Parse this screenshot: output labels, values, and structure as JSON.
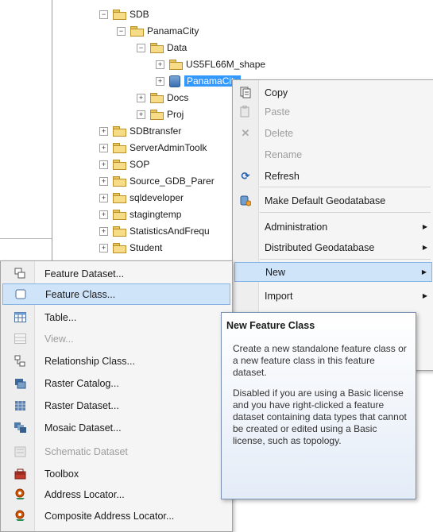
{
  "tree": {
    "nodes": [
      {
        "label": "SDB",
        "expander": "−",
        "icon": "folder"
      },
      {
        "label": "PanamaCity",
        "expander": "−",
        "icon": "folder"
      },
      {
        "label": "Data",
        "expander": "−",
        "icon": "folder"
      },
      {
        "label": "US5FL66M_shape",
        "expander": "+",
        "icon": "folder"
      },
      {
        "label": "PanamaCity",
        "expander": "+",
        "icon": "geodatabase",
        "selected": true
      },
      {
        "label": "Docs",
        "expander": "+",
        "icon": "folder"
      },
      {
        "label": "Proj",
        "expander": "+",
        "icon": "folder"
      },
      {
        "label": "SDBtransfer",
        "expander": "+",
        "icon": "folder"
      },
      {
        "label": "ServerAdminToolk",
        "expander": "+",
        "icon": "folder"
      },
      {
        "label": "SOP",
        "expander": "+",
        "icon": "folder"
      },
      {
        "label": "Source_GDB_Parer",
        "expander": "+",
        "icon": "folder"
      },
      {
        "label": "sqldeveloper",
        "expander": "+",
        "icon": "folder"
      },
      {
        "label": "stagingtemp",
        "expander": "+",
        "icon": "folder"
      },
      {
        "label": "StatisticsAndFrequ",
        "expander": "+",
        "icon": "folder"
      },
      {
        "label": "Student",
        "expander": "+",
        "icon": "folder"
      }
    ]
  },
  "context_menu": {
    "items": [
      {
        "label": "Copy",
        "icon": "copy-icon"
      },
      {
        "label": "Paste",
        "icon": "paste-icon",
        "disabled": true
      },
      {
        "label": "Delete",
        "icon": "delete-icon",
        "disabled": true
      },
      {
        "label": "Rename",
        "icon": "",
        "disabled": true
      },
      {
        "label": "Refresh",
        "icon": "refresh-icon"
      },
      {
        "label": "Make Default Geodatabase",
        "icon": "default-gdb-icon"
      },
      {
        "label": "Administration",
        "submenu": true
      },
      {
        "label": "Distributed Geodatabase",
        "submenu": true
      },
      {
        "label": "New",
        "submenu": true,
        "highlighted": true
      },
      {
        "label": "Import",
        "submenu": true
      }
    ]
  },
  "new_submenu": {
    "items": [
      {
        "label": "Feature Dataset...",
        "icon": "feature-dataset-icon"
      },
      {
        "label": "Feature Class...",
        "icon": "feature-class-icon",
        "highlighted": true
      },
      {
        "label": "Table...",
        "icon": "table-icon"
      },
      {
        "label": "View...",
        "icon": "view-icon",
        "disabled": true
      },
      {
        "label": "Relationship Class...",
        "icon": "relationship-class-icon"
      },
      {
        "label": "Raster Catalog...",
        "icon": "raster-catalog-icon"
      },
      {
        "label": "Raster Dataset...",
        "icon": "raster-dataset-icon"
      },
      {
        "label": "Mosaic Dataset...",
        "icon": "mosaic-dataset-icon"
      },
      {
        "label": "Schematic Dataset",
        "icon": "schematic-dataset-icon",
        "disabled": true
      },
      {
        "label": "Toolbox",
        "icon": "toolbox-icon"
      },
      {
        "label": "Address Locator...",
        "icon": "address-locator-icon"
      },
      {
        "label": "Composite Address Locator...",
        "icon": "composite-locator-icon"
      }
    ]
  },
  "tooltip": {
    "title": "New Feature Class",
    "paragraph1": "Create a new standalone feature class or a new feature class in this feature dataset.",
    "paragraph2": "Disabled if you are using a Basic license and you have right-clicked a feature dataset containing data types that cannot be created or edited using a Basic license, such as topology."
  }
}
